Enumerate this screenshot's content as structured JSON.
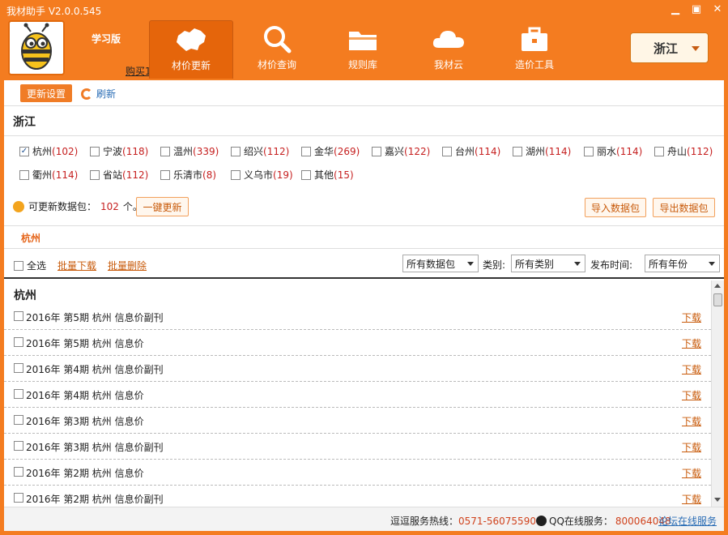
{
  "window": {
    "title": "我材助手  V2.0.0.545"
  },
  "header": {
    "edition": "学习版",
    "buy": "购买1",
    "nav": [
      {
        "label": "材价更新",
        "icon": "map-icon",
        "active": true
      },
      {
        "label": "材价查询",
        "icon": "search-icon",
        "active": false
      },
      {
        "label": "规则库",
        "icon": "folder-icon",
        "active": false
      },
      {
        "label": "我材云",
        "icon": "cloud-icon",
        "active": false
      },
      {
        "label": "造价工具",
        "icon": "toolbox-icon",
        "active": false
      }
    ],
    "region": "浙江"
  },
  "toolbar": {
    "settings": "更新设置",
    "refresh": "刷新"
  },
  "province": {
    "title": "浙江",
    "cities": [
      {
        "name": "杭州",
        "count": "(102)",
        "checked": true
      },
      {
        "name": "宁波",
        "count": "(118)",
        "checked": false
      },
      {
        "name": "温州",
        "count": "(339)",
        "checked": false
      },
      {
        "name": "绍兴",
        "count": "(112)",
        "checked": false
      },
      {
        "name": "金华",
        "count": "(269)",
        "checked": false
      },
      {
        "name": "嘉兴",
        "count": "(122)",
        "checked": false
      },
      {
        "name": "台州",
        "count": "(114)",
        "checked": false
      },
      {
        "name": "湖州",
        "count": "(114)",
        "checked": false
      },
      {
        "name": "丽水",
        "count": "(114)",
        "checked": false
      },
      {
        "name": "舟山",
        "count": "(112)",
        "checked": false
      },
      {
        "name": "衢州",
        "count": "(114)",
        "checked": false
      },
      {
        "name": "省站",
        "count": "(112)",
        "checked": false
      },
      {
        "name": "乐清市",
        "count": "(8)",
        "checked": false
      },
      {
        "name": "义乌市",
        "count": "(19)",
        "checked": false
      },
      {
        "name": "其他",
        "count": "(15)",
        "checked": false
      }
    ],
    "updatable_label": "可更新数据包：",
    "updatable_count": "102",
    "updatable_unit": "个。",
    "one_key_update": "一键更新",
    "import": "导入数据包",
    "export": "导出数据包"
  },
  "city_tab": "杭州",
  "filters": {
    "select_all": "全选",
    "batch_download": "批量下载",
    "batch_delete": "批量删除",
    "package_select": "所有数据包",
    "category_label": "类别:",
    "category_select": "所有类别",
    "date_label": "发布时间:",
    "date_select": "所有年份"
  },
  "list": {
    "city": "杭州",
    "download_label": "下载",
    "rows": [
      "2016年 第5期 杭州 信息价副刊",
      "2016年 第5期 杭州 信息价",
      "2016年 第4期 杭州 信息价副刊",
      "2016年 第4期 杭州 信息价",
      "2016年 第3期 杭州 信息价",
      "2016年 第3期 杭州 信息价副刊",
      "2016年 第2期 杭州 信息价",
      "2016年 第2期 杭州 信息价副刊"
    ]
  },
  "status": {
    "hotline_label": "逗逗服务热线：",
    "hotline": "0571-56075590",
    "qq_label": "QQ在线服务：",
    "qq_number": "800064048",
    "forum": "论坛在线服务"
  },
  "colors": {
    "brand": "#f47c20",
    "link": "#c85a0a",
    "count": "#c62020"
  }
}
